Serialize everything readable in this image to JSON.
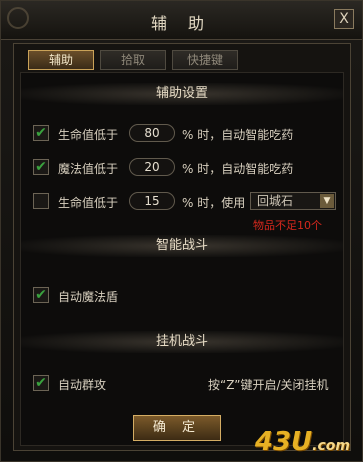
{
  "window": {
    "title": "辅 助",
    "close_label": "X"
  },
  "tabs": [
    {
      "label": "辅助",
      "active": true
    },
    {
      "label": "拾取",
      "active": false
    },
    {
      "label": "快捷键",
      "active": false
    }
  ],
  "sections": {
    "assist_settings": "辅助设置",
    "smart_combat": "智能战斗",
    "afk_combat": "挂机战斗"
  },
  "assist_rows": [
    {
      "checked": true,
      "label": "生命值低于",
      "value": "80",
      "suffix": "% 时，自动智能吃药"
    },
    {
      "checked": true,
      "label": "魔法值低于",
      "value": "20",
      "suffix": "% 时，自动智能吃药"
    },
    {
      "checked": false,
      "label": "生命值低于",
      "value": "15",
      "suffix": "% 时，使用",
      "select": "回城石"
    }
  ],
  "warning": "物品不足10个",
  "smart_combat": {
    "checked": true,
    "label": "自动魔法盾"
  },
  "afk_combat": {
    "checked": true,
    "label": "自动群攻",
    "hint": "按“Z”键开启/关闭挂机"
  },
  "confirm_label": "确 定",
  "watermark": {
    "main": "43U",
    "small": ".com"
  },
  "colors": {
    "check": "#3aa23e",
    "warning": "#d5281d",
    "accent": "#caa258"
  }
}
